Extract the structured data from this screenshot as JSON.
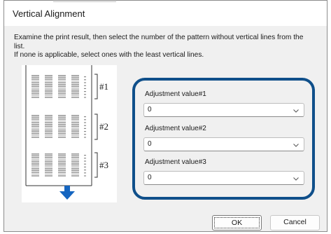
{
  "dialog": {
    "title": "Vertical Alignment",
    "instruction_line1": "Examine the print result, then select the number of the pattern without vertical lines from the",
    "instruction_line2": "list.",
    "instruction_line3": "If none is applicable, select ones with the least vertical lines."
  },
  "pattern_image": {
    "labels": [
      "#1",
      "#2",
      "#3"
    ],
    "arrow_color": "#1565c0"
  },
  "adjustments": [
    {
      "label": "Adjustment value#1",
      "value": "0"
    },
    {
      "label": "Adjustment value#2",
      "value": "0"
    },
    {
      "label": "Adjustment value#3",
      "value": "0"
    }
  ],
  "highlight_color": "#0f4f8a",
  "buttons": {
    "ok": "OK",
    "cancel": "Cancel"
  },
  "icons": {
    "dropdown": "chevron-down-icon"
  }
}
